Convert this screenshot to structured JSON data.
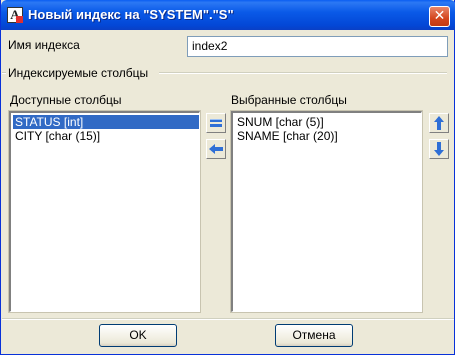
{
  "window": {
    "title": "Новый индекс на \"SYSTEM\".\"S\""
  },
  "index_name": {
    "label": "Имя индекса",
    "value": "index2"
  },
  "group": {
    "title": "Индексируемые столбцы"
  },
  "available": {
    "label": "Доступные столбцы",
    "items": [
      "STATUS [int]",
      "CITY [char (15)]"
    ],
    "selected_index": 0
  },
  "chosen": {
    "label": "Выбранные столбцы",
    "items": [
      "SNUM [char (5)]",
      "SNAME [char (20)]"
    ]
  },
  "buttons": {
    "ok": "OK",
    "cancel": "Отмена"
  },
  "icons": {
    "app": "app-icon",
    "close": "close-icon",
    "add": "move-right-icon",
    "remove": "move-left-icon",
    "up": "arrow-up-icon",
    "down": "arrow-down-icon"
  },
  "colors": {
    "titlebar": "#0a5ae8",
    "selection": "#316ac5",
    "dialog": "#ece9d8"
  }
}
